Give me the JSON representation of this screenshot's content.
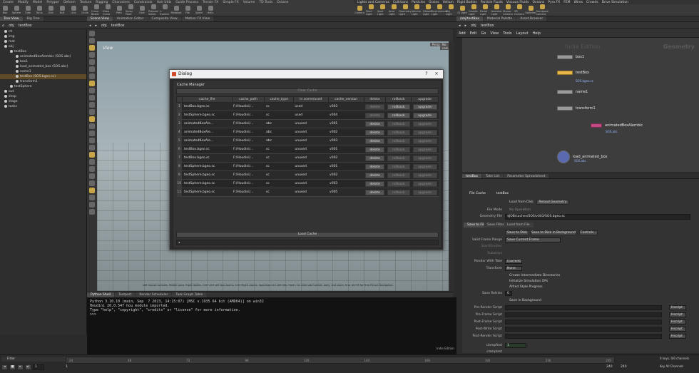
{
  "shelf_tabs_left": [
    "Create",
    "Modify",
    "Model",
    "Polygon",
    "Deform",
    "Texture",
    "Rigging",
    "Characters",
    "Constraints",
    "Hair Utils",
    "Guide Process",
    "Terrain FX",
    "Simple FX",
    "Volume",
    "TD Tools",
    "Octane"
  ],
  "shelf_tabs_right": [
    "Lights and Cameras",
    "Collisions",
    "Particles",
    "Grains",
    "Vellum",
    "Rigid Bodies",
    "Particle Fluids",
    "Viscous Fluids",
    "Oceans",
    "Pyro FX",
    "FEM",
    "Wires",
    "Crowds",
    "Drive Simulation"
  ],
  "shelf_tools_left": [
    "Box",
    "Sphere",
    "Tube",
    "Torus",
    "Grid",
    "Null",
    "Line",
    "Circle",
    "Curve Bezier",
    "Draw Curve",
    "Path",
    "Spray Paint",
    "Font",
    "Platonic Solids",
    "L-System",
    "Metaball",
    "File",
    "Spiral",
    "Helix"
  ],
  "shelf_tools_right": [
    "Camera",
    "Point Light",
    "Spot Light",
    "Area Light",
    "Geometry Light",
    "Volume Light",
    "Distant Light",
    "Environment Light",
    "Sky Light",
    "GI Light",
    "Caustic Light",
    "Portal Light",
    "Ambient Light",
    "Stereo Camera",
    "VR Camera",
    "Switcher",
    "Gamepad Camera"
  ],
  "pane_tabs_left": [
    "Tree View",
    "Big Tree"
  ],
  "pane_tabs_mid": [
    "Scene View",
    "Animation Editor",
    "Composite View",
    "Motion FX View"
  ],
  "pane_tabs_right": [
    "/obj/testBox",
    "Material Palette",
    "Asset Browser"
  ],
  "left_path": [
    "obj",
    "testBox"
  ],
  "mid_path": [
    "obj",
    "testBox"
  ],
  "right_path": [
    "obj",
    "testBox"
  ],
  "tree": [
    {
      "label": "ch",
      "indent": 0
    },
    {
      "label": "img",
      "indent": 0
    },
    {
      "label": "mat",
      "indent": 0
    },
    {
      "label": "obj",
      "indent": 0
    },
    {
      "label": "testBox",
      "indent": 1
    },
    {
      "label": "animatedBoxAlembic (SOS.abc)",
      "indent": 2
    },
    {
      "label": "box1",
      "indent": 2
    },
    {
      "label": "load_animated_box (SOS.abc)",
      "indent": 2
    },
    {
      "label": "name1",
      "indent": 2
    },
    {
      "label": "testBox (SOS.bgeo.sc)",
      "indent": 2,
      "selected": true
    },
    {
      "label": "transform1",
      "indent": 2
    },
    {
      "label": "testSphere",
      "indent": 1
    },
    {
      "label": "out",
      "indent": 0
    },
    {
      "label": "shop",
      "indent": 0
    },
    {
      "label": "stage",
      "indent": 0
    },
    {
      "label": "tasks",
      "indent": 0
    }
  ],
  "viewport": {
    "label": "View",
    "persp": "Persp ▾",
    "cam": "No cam ▾",
    "hint": "Left mouse tumbles. Middle pans. Right dollies. Ctrl+Alt+Left box-zooms. Ctrl+Right zooms. Spacebar-Ctrl-Left tilts. Hold L for alternate tumble, dolly, and zoom. M or Alt+M for First Person Navigation."
  },
  "bottom_tabs": [
    "Python Shell",
    "Textport",
    "Render Scheduler",
    "Task Graph Table"
  ],
  "console_lines": [
    "Python 3.10.10 (main, Sep  7 2023, 14:15:07) [MSC v.1935 64 bit (AMD64)] on win32",
    "Houdini 20.0.547 hou module imported.",
    "Type \"help\", \"copyright\", \"credits\" or \"license\" for more information.",
    ">>> "
  ],
  "console_footer": "Indie Edition",
  "network": {
    "menu": [
      "Add",
      "Edit",
      "Go",
      "View",
      "Tools",
      "Layout",
      "Help"
    ],
    "watermark": "Indie Edition",
    "context": "Geometry",
    "nodes": [
      {
        "name": "box1",
        "sub": ""
      },
      {
        "name": "testBox",
        "sub": "SOS.bgeo.sc"
      },
      {
        "name": "name1",
        "sub": ""
      },
      {
        "name": "transform1",
        "sub": ""
      },
      {
        "name": "animatedBoxAlembic",
        "sub": "SOS.abc"
      },
      {
        "name": "load_animated_box",
        "sub": "SOS.abc"
      }
    ]
  },
  "param_tabs": [
    "testBox",
    "Take List",
    "Parameter Spreadsheet"
  ],
  "params": {
    "header_type": "File Cache",
    "header_name": "testBox",
    "load_from_disk": "Load from Disk",
    "reload": "Reload Geometry",
    "file_mode_label": "File Mode",
    "file_mode": "No Operation",
    "geometry_file_label": "Geometry File",
    "geometry_file": "$JOB/caches/SOS/v003/SOS.bgeo.sc",
    "subtabs": [
      "Save to File",
      "Save Filter",
      "Load from File"
    ],
    "save_disk": "Save to Disk",
    "save_bg": "Save to Disk in Background",
    "controls": "Controls...",
    "valid_frame_range_label": "Valid Frame Range",
    "valid_frame_range": "Save Current Frame",
    "start_end_label": "Start/End/Inc",
    "substeps_label": "Substeps",
    "render_take_label": "Render With Take",
    "render_take": "(current)",
    "transform_label": "Transform",
    "transform": "None",
    "create_dirs": "Create Intermediate Directories",
    "init_sim": "Initialize Simulation OPs",
    "alfred": "Alfred Style Progress",
    "save_retries_label": "Save Retries",
    "save_retries": "0",
    "save_bg_check": "Save in Background",
    "scripts": [
      "Pre-Render Script",
      "Pre-Frame Script",
      "Post-Frame Script",
      "Post-Write Script",
      "Post-Render Script"
    ],
    "script_lang": "Hscript",
    "clampfirst_label": "clampfirst",
    "clampfirst": "1",
    "clamplast_label": "clamplast"
  },
  "timeline": {
    "start": "1",
    "end": "240",
    "current": "1",
    "end2": "240",
    "right": "0 keys, 0/0 channels",
    "all_channels": "Key All Channels",
    "filter": "Filter",
    "ticks": [
      "24",
      "48",
      "72",
      "96",
      "120",
      "144",
      "168",
      "192",
      "216",
      "240"
    ]
  },
  "dialog": {
    "title": "Dialog",
    "help": "?",
    "close": "×",
    "group": "Cache Manager",
    "clear_cache": "Clear Cache",
    "load_cache": "Load Cache",
    "columns": [
      "cache_file",
      "cache_path",
      "cache_type",
      "in scene/used",
      "cache_version",
      "delete",
      "rollback",
      "upgrade"
    ],
    "rows": [
      {
        "n": "1",
        "file": "testBox.bgeo.sc",
        "path": "F:/Houdini/...",
        "type": "sc",
        "used": "used",
        "ver": "v003",
        "del": false,
        "rb": true,
        "up": true
      },
      {
        "n": "2",
        "file": "testSphere.bgeo.sc",
        "path": "F:/Houdini/...",
        "type": "sc",
        "used": "used",
        "ver": "v004",
        "del": false,
        "rb": true,
        "up": true
      },
      {
        "n": "3",
        "file": "animatedBoxAle...",
        "path": "F:/Houdini/...",
        "type": "abc",
        "used": "unused",
        "ver": "v001",
        "del": true,
        "rb": false,
        "up": false
      },
      {
        "n": "4",
        "file": "animatedBoxAle...",
        "path": "F:/Houdini/...",
        "type": "abc",
        "used": "unused",
        "ver": "v002",
        "del": true,
        "rb": false,
        "up": false
      },
      {
        "n": "5",
        "file": "animatedBoxAle...",
        "path": "F:/Houdini/...",
        "type": "abc",
        "used": "unused",
        "ver": "v003",
        "del": true,
        "rb": false,
        "up": false
      },
      {
        "n": "6",
        "file": "testBox.bgeo.sc",
        "path": "F:/Houdini/...",
        "type": "sc",
        "used": "unused",
        "ver": "v001",
        "del": true,
        "rb": false,
        "up": false
      },
      {
        "n": "7",
        "file": "testBox.bgeo.sc",
        "path": "F:/Houdini/...",
        "type": "sc",
        "used": "unused",
        "ver": "v002",
        "del": true,
        "rb": false,
        "up": false
      },
      {
        "n": "8",
        "file": "testSphere.bgeo.sc",
        "path": "F:/Houdini/...",
        "type": "sc",
        "used": "unused",
        "ver": "v001",
        "del": true,
        "rb": false,
        "up": false
      },
      {
        "n": "9",
        "file": "testSphere.bgeo.sc",
        "path": "F:/Houdini/...",
        "type": "sc",
        "used": "unused",
        "ver": "v002",
        "del": true,
        "rb": false,
        "up": false
      },
      {
        "n": "10",
        "file": "testSphere.bgeo.sc",
        "path": "F:/Houdini/...",
        "type": "sc",
        "used": "unused",
        "ver": "v003",
        "del": true,
        "rb": false,
        "up": false
      },
      {
        "n": "11",
        "file": "testSphere.bgeo.sc",
        "path": "F:/Houdini/...",
        "type": "sc",
        "used": "unused",
        "ver": "v005",
        "del": true,
        "rb": false,
        "up": false
      }
    ],
    "btn_delete": "delete",
    "btn_rollback": "rollback",
    "btn_upgrade": "upgrade"
  }
}
